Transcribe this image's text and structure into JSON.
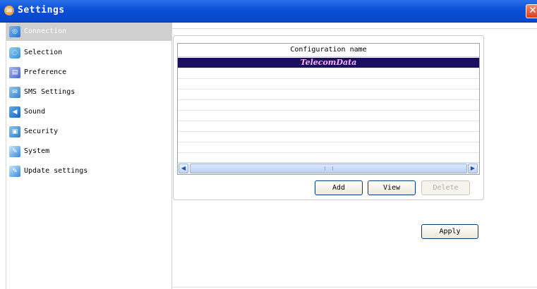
{
  "window": {
    "title": "Settings",
    "app_icon_text": "3G",
    "close_glyph": "✕"
  },
  "sidebar": {
    "items": [
      {
        "label": "Connection",
        "icon": "connection-icon",
        "selected": true
      },
      {
        "label": "Selection",
        "icon": "selection-icon",
        "selected": false
      },
      {
        "label": "Preference",
        "icon": "preference-icon",
        "selected": false
      },
      {
        "label": "SMS Settings",
        "icon": "sms-icon",
        "selected": false
      },
      {
        "label": "Sound",
        "icon": "speaker-icon",
        "selected": false
      },
      {
        "label": "Security",
        "icon": "lock-icon",
        "selected": false
      },
      {
        "label": "System",
        "icon": "system-icon",
        "selected": false
      },
      {
        "label": "Update settings",
        "icon": "update-icon",
        "selected": false
      }
    ]
  },
  "config_table": {
    "column_header": "Configuration name",
    "rows": [
      "TelecomData"
    ],
    "selected_row": 0
  },
  "buttons": {
    "add": "Add",
    "view": "View",
    "delete": "Delete",
    "apply": "Apply"
  },
  "colors": {
    "titlebar": "#0a4fd6",
    "selected_row_bg": "#1c0e5e",
    "selected_row_text": "#ffb0ff",
    "sidebar_selected_bg": "#cfcfcf"
  }
}
